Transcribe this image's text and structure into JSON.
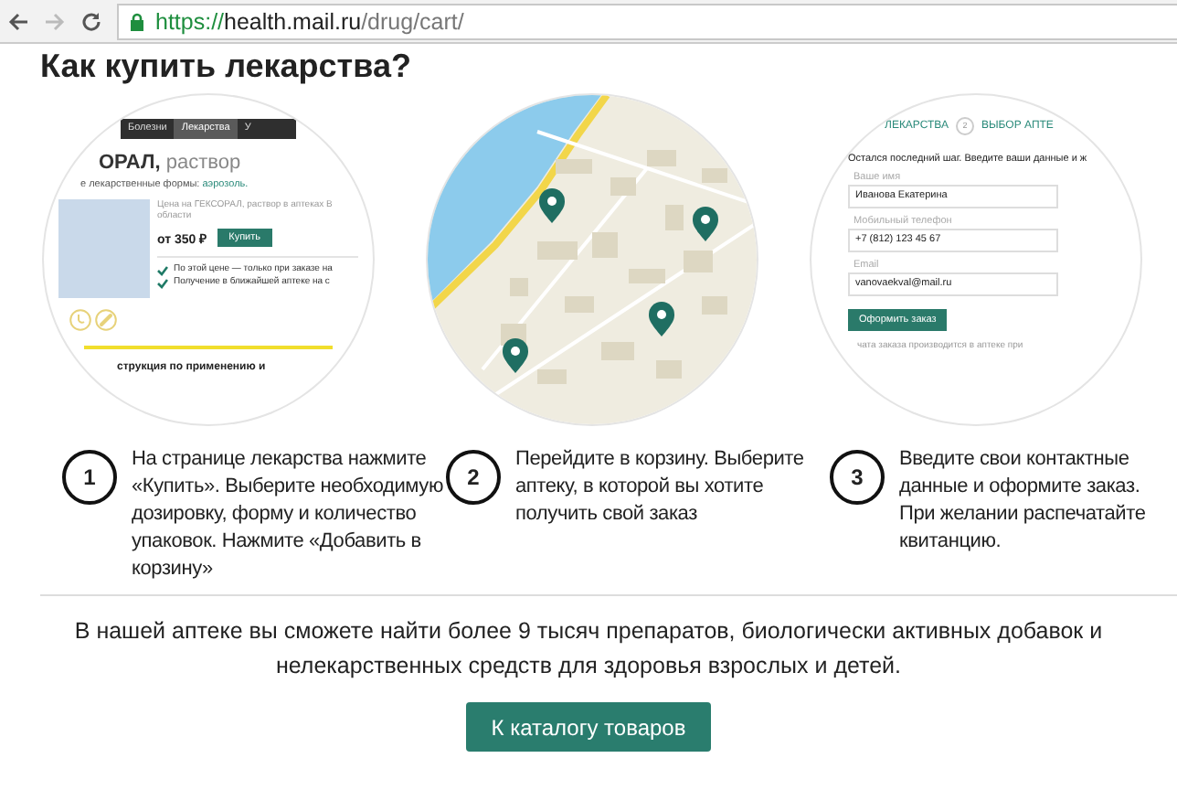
{
  "browser": {
    "url_parts": [
      {
        "kind": "scheme",
        "text": "https://"
      },
      {
        "kind": "host",
        "text": "health.mail.ru"
      },
      {
        "kind": "path",
        "text": "/drug/cart/"
      }
    ]
  },
  "heading": "Как купить лекарства?",
  "illustrations": [
    {
      "kind": "product",
      "tabs": [
        {
          "label": "Болезни",
          "selected": false
        },
        {
          "label": "Лекарства",
          "selected": true
        },
        {
          "label": "У",
          "selected": false
        }
      ],
      "title": "**ОРАЛ,** раствор",
      "forms_label": "е лекарственные формы:",
      "forms_link": "аэрозоль.",
      "price_note": "Цена на ГЕКСОРАЛ, раствор в аптеках В области",
      "price": "от 350 ₽",
      "buy_button": "Купить",
      "checks": [
        "По этой цене — только при заказе на",
        "Получение в ближайшей аптеке на с"
      ],
      "instruction": "струкция по применению и"
    },
    {
      "kind": "map"
    },
    {
      "kind": "form",
      "steps": [
        {
          "label": "ЛЕКАРСТВА"
        },
        {
          "number": "2",
          "label": "ВЫБОР АПТЕ"
        }
      ],
      "intro": "Остался последний шаг. Введите ваши данные и ж",
      "fields": [
        {
          "label": "Ваше имя",
          "value": "Иванова Екатерина"
        },
        {
          "label": "Мобильный телефон",
          "value": "+7 (812) 123 45 67"
        },
        {
          "label": "Email",
          "value": "vanovaekval@mail.ru"
        }
      ],
      "submit_button": "Оформить заказ",
      "note": "чата заказа производится в аптеке при"
    }
  ],
  "steps": [
    {
      "number": "1",
      "text": "На странице лекарства нажмите «Купить». Выберите необходимую дозировку, форму и количество упаковок. Нажмите «Добавить в корзину»"
    },
    {
      "number": "2",
      "text": "Перейдите в корзину. Выберите аптеку, в которой вы хотите получить свой заказ"
    },
    {
      "number": "3",
      "text": "Введите свои контактные данные и оформите заказ. При желании распечатайте квитанцию."
    }
  ],
  "summary": "В нашей аптеке вы сможете найти более 9 тысяч препаратов, биологически активных добавок и нелекарственных средств для здоровья взрослых и детей.",
  "catalog_button": "К каталогу товаров"
}
